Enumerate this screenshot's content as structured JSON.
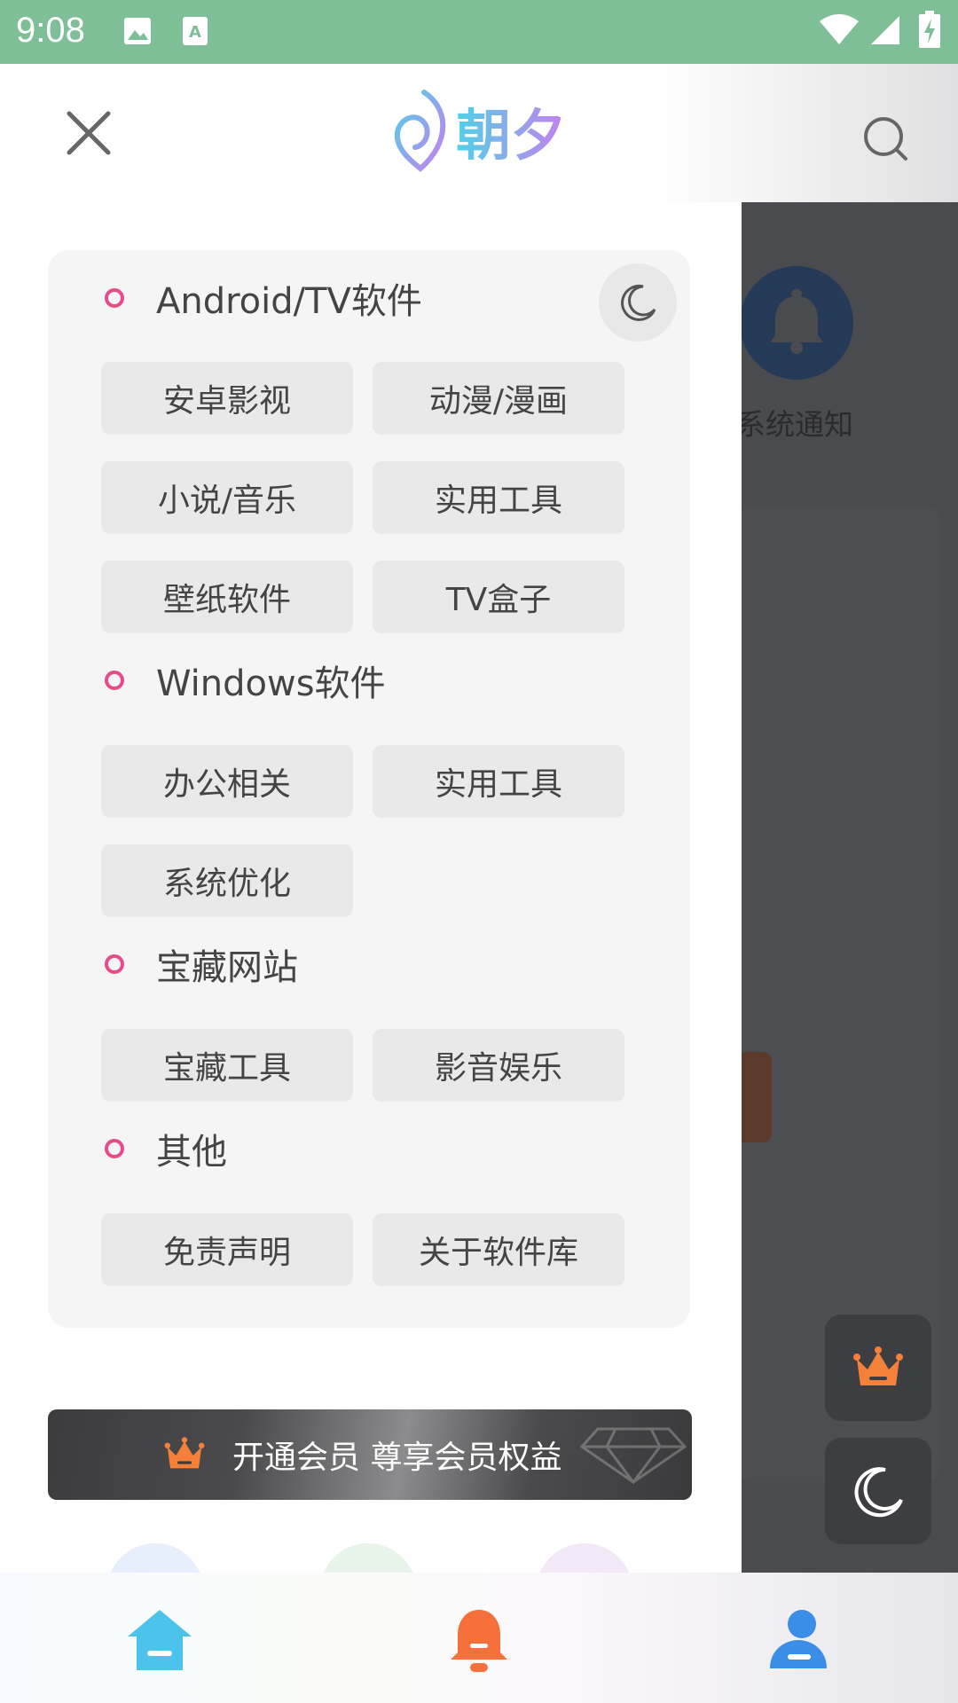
{
  "status_bar": {
    "time": "9:08"
  },
  "header": {
    "logo_text": "朝夕"
  },
  "background_page": {
    "notify_label": "系统通知"
  },
  "sections": [
    {
      "title": "Android/TV软件",
      "tags": [
        "安卓影视",
        "动漫/漫画",
        "小说/音乐",
        "实用工具",
        "壁纸软件",
        "TV盒子"
      ]
    },
    {
      "title": "Windows软件",
      "tags": [
        "办公相关",
        "实用工具",
        "系统优化"
      ]
    },
    {
      "title": "宝藏网站",
      "tags": [
        "宝藏工具",
        "影音娱乐"
      ]
    },
    {
      "title": "其他",
      "tags": [
        "免责声明",
        "关于软件库"
      ]
    }
  ],
  "vip_banner": {
    "text": "开通会员 尊享会员权益"
  },
  "bottom_nav": {
    "items": [
      "home-icon",
      "bell-icon",
      "user-icon"
    ]
  },
  "colors": {
    "status_bar": "#7fbf97",
    "accent_pink": "#e84b8a",
    "home_blue": "#4cc3ea",
    "bell_orange": "#f5703a",
    "user_blue": "#3b8ee8"
  }
}
